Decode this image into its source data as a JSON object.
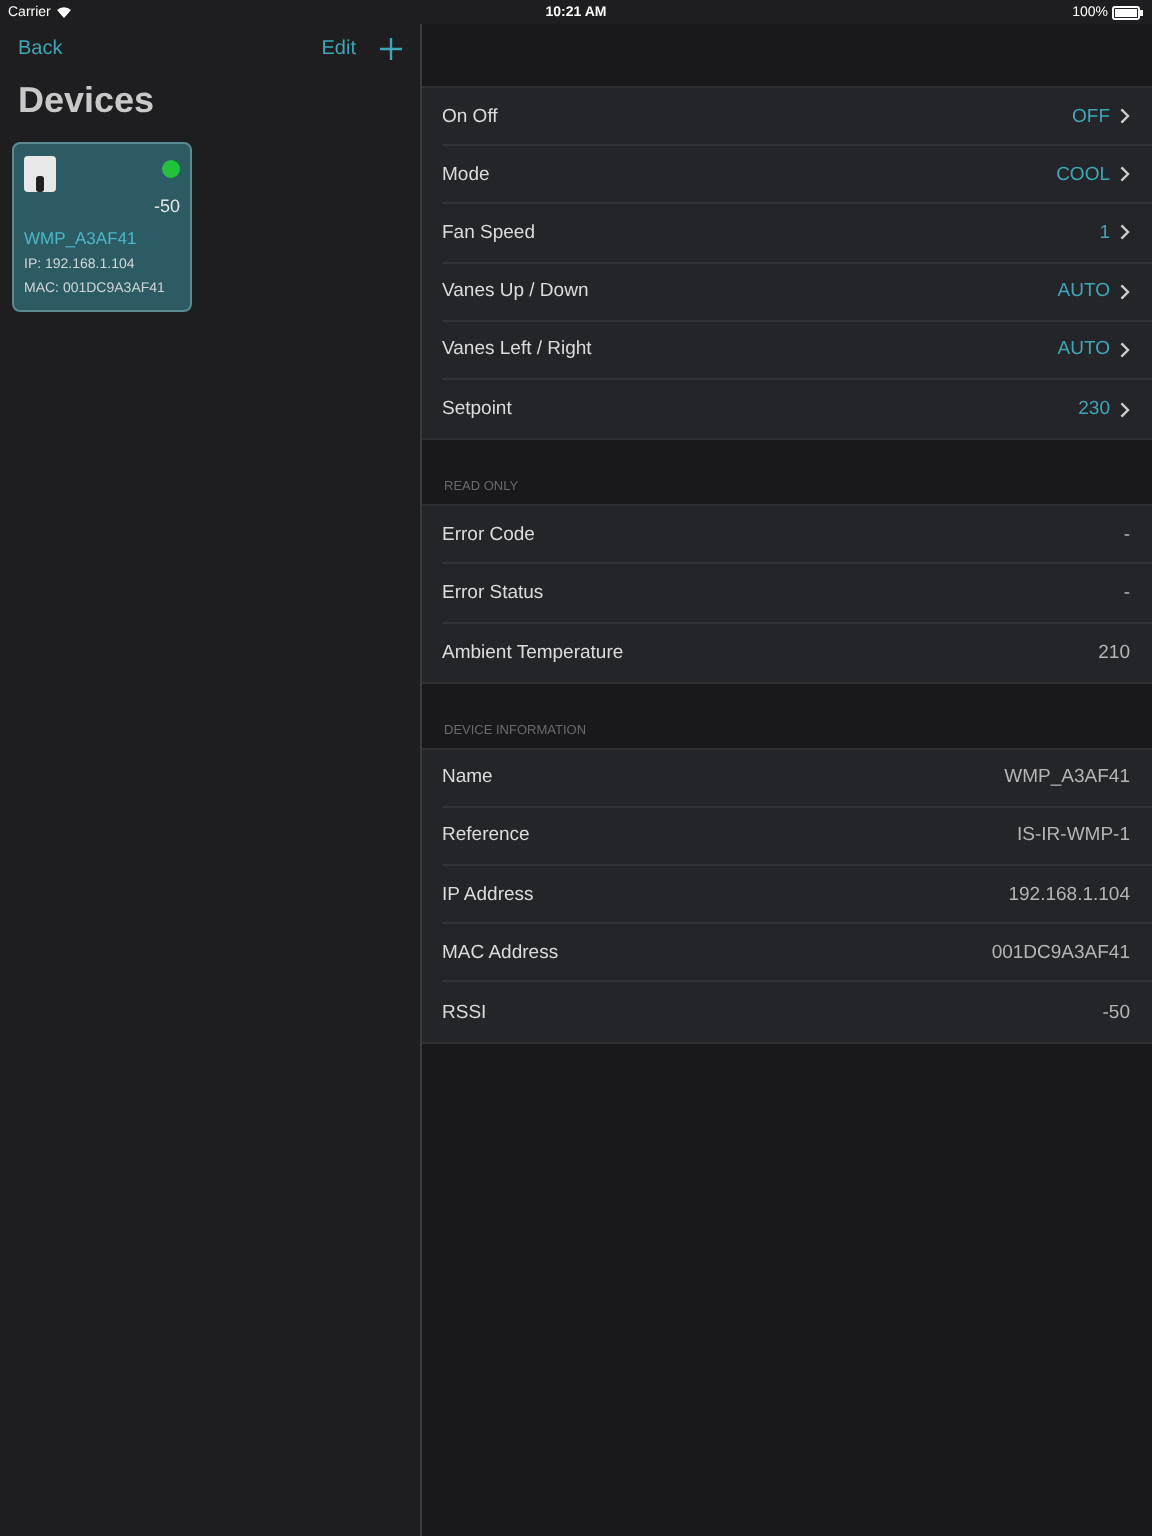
{
  "status_bar": {
    "carrier": "Carrier",
    "time": "10:21 AM",
    "battery": "100%"
  },
  "sidebar": {
    "back": "Back",
    "edit": "Edit",
    "title": "Devices",
    "devices": [
      {
        "name": "WMP_A3AF41",
        "rssi": "-50",
        "ip": "IP: 192.168.1.104",
        "mac": "MAC: 001DC9A3AF41",
        "color": "#22c33a",
        "selected": true
      }
    ]
  },
  "sections": [
    {
      "rows": [
        {
          "kind": "link",
          "label": "On Off",
          "value": "OFF"
        },
        {
          "kind": "link",
          "label": "Mode",
          "value": "COOL"
        },
        {
          "kind": "link",
          "label": "Fan Speed",
          "value": "1"
        },
        {
          "kind": "link",
          "label": "Vanes Up / Down",
          "value": "AUTO"
        },
        {
          "kind": "link",
          "label": "Vanes Left / Right",
          "value": "AUTO"
        },
        {
          "kind": "link",
          "label": "Setpoint",
          "value": "230"
        }
      ]
    },
    {
      "header": "READ ONLY",
      "rows": [
        {
          "kind": "info",
          "label": "Error Code",
          "value": "-"
        },
        {
          "kind": "info",
          "label": "Error Status",
          "value": "-"
        },
        {
          "kind": "info",
          "label": "Ambient Temperature",
          "value": "210"
        }
      ]
    },
    {
      "header": "DEVICE INFORMATION",
      "rows": [
        {
          "kind": "info",
          "label": "Name",
          "value": "WMP_A3AF41"
        },
        {
          "kind": "info",
          "label": "Reference",
          "value": "IS-IR-WMP-1"
        },
        {
          "kind": "info",
          "label": "IP Address",
          "value": "192.168.1.104"
        },
        {
          "kind": "info",
          "label": "MAC Address",
          "value": "001DC9A3AF41"
        },
        {
          "kind": "info",
          "label": "RSSI",
          "value": "-50"
        }
      ]
    }
  ]
}
